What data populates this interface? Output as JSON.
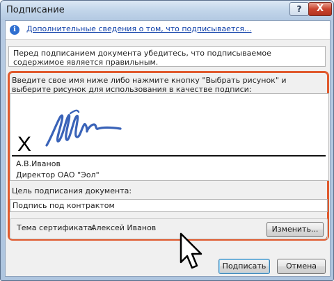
{
  "window": {
    "title": "Подписание"
  },
  "titlebar": {
    "help_label": "?",
    "close_label": "X"
  },
  "info_link": "Дополнительные сведения о том, что подписывается...",
  "notice": "Перед подписанием документа убедитесь, что подписываемое содержимое является правильным.",
  "instructions": "Введите свое имя ниже либо нажмите кнопку \"Выбрать рисунок\" и выберите рисунок для использования в качестве подписи:",
  "signature": {
    "x_mark": "X",
    "signer_name": "А.В.Иванов",
    "signer_title": "Директор ОАО \"Эол\""
  },
  "purpose": {
    "label": "Цель подписания документа:",
    "value": "Подпись под контрактом"
  },
  "certificate": {
    "label": "Тема сертификата:",
    "value": "Алексей Иванов",
    "change_button": "Изменить..."
  },
  "buttons": {
    "sign": "Подписать",
    "cancel": "Отмена"
  },
  "colors": {
    "highlight_frame": "#e05a2e",
    "link": "#0c3ea8",
    "signature_ink": "#3a63b8"
  }
}
